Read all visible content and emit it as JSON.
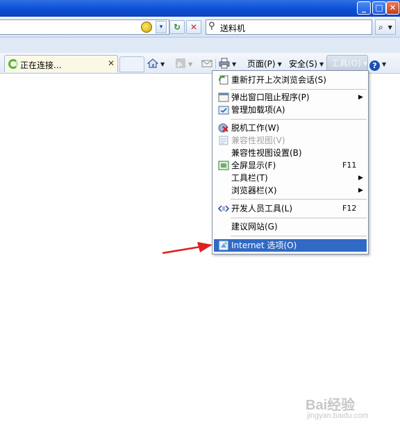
{
  "titlebar": {
    "minimize_glyph": "_",
    "maximize_glyph": "□",
    "close_glyph": "✕"
  },
  "address_bar": {
    "dropdown_glyph": "▾",
    "refresh_glyph": "↻",
    "stop_glyph": "✕"
  },
  "search": {
    "value": "送料机",
    "button_glyph": "⌕"
  },
  "tab": {
    "label": "正在连接...",
    "close_glyph": "✕"
  },
  "command_bar": {
    "page_label": "页面(P)",
    "safety_label": "安全(S)",
    "tools_label": "工具(O)",
    "help_glyph": "?"
  },
  "tools_menu": {
    "items": [
      {
        "label": "重新打开上次浏览会话(S)",
        "shortcut": "",
        "submenu": false,
        "disabled": false,
        "icon": "reopen-session-icon"
      },
      {
        "label": "弹出窗口阻止程序(P)",
        "shortcut": "",
        "submenu": true,
        "disabled": false,
        "icon": "popup-blocker-icon"
      },
      {
        "label": "管理加载项(A)",
        "shortcut": "",
        "submenu": false,
        "disabled": false,
        "icon": "manage-addons-icon"
      },
      {
        "label": "脱机工作(W)",
        "shortcut": "",
        "submenu": false,
        "disabled": false,
        "icon": "work-offline-icon"
      },
      {
        "label": "兼容性视图(V)",
        "shortcut": "",
        "submenu": false,
        "disabled": true,
        "icon": "compatibility-view-icon"
      },
      {
        "label": "兼容性视图设置(B)",
        "shortcut": "",
        "submenu": false,
        "disabled": false,
        "icon": ""
      },
      {
        "label": "全屏显示(F)",
        "shortcut": "F11",
        "submenu": false,
        "disabled": false,
        "icon": "fullscreen-icon"
      },
      {
        "label": "工具栏(T)",
        "shortcut": "",
        "submenu": true,
        "disabled": false,
        "icon": ""
      },
      {
        "label": "浏览器栏(X)",
        "shortcut": "",
        "submenu": true,
        "disabled": false,
        "icon": ""
      },
      {
        "label": "开发人员工具(L)",
        "shortcut": "F12",
        "submenu": false,
        "disabled": false,
        "icon": "developer-tools-icon"
      },
      {
        "label": "建议网站(G)",
        "shortcut": "",
        "submenu": false,
        "disabled": false,
        "icon": ""
      },
      {
        "label": "Internet 选项(O)",
        "shortcut": "",
        "submenu": false,
        "disabled": false,
        "highlighted": true,
        "icon": "internet-options-icon"
      }
    ],
    "submenu_glyph": "▶"
  },
  "watermark": {
    "brand": "Bai经验",
    "sub": "jingyan.baidu.com"
  },
  "colors": {
    "titlebar_blue": "#0a4fd6",
    "menu_highlight": "#316ac5",
    "annotation_arrow": "#e02020",
    "tab_loading": "#58b040"
  }
}
